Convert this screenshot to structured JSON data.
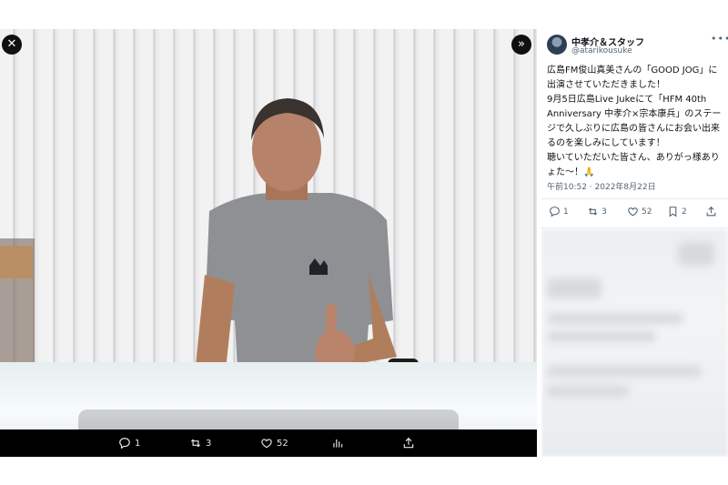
{
  "viewer": {
    "close_icon": "close-icon",
    "next_icon": "chevron-double-right-icon",
    "photo_description_icon": "photo",
    "bar": {
      "replies": "1",
      "retweets": "3",
      "likes": "52"
    }
  },
  "tweet": {
    "author_name": "中孝介＆スタッフ",
    "author_handle": "@atarikousuke",
    "lines": [
      "広島FM俊山真美さんの「GOOD JOG」に出演させていただきました！",
      "9月5日広島Live Jukeにて「HFM 40th Anniversary 中孝介×宗本康兵」のステージで久しぶりに広島の皆さんにお会い出来るのを楽しみにしています！",
      "聴いていただいた皆さん、ありがっ様ありょた〜！🙏"
    ],
    "timestamp": "午前10:52 · 2022年8月22日",
    "stats": {
      "replies": "1",
      "retweets": "3",
      "likes": "52",
      "bookmarks": "2"
    }
  },
  "colors": {
    "viewer_bg": "#000000",
    "text_primary": "#0f1419",
    "text_secondary": "#536471",
    "divider": "#e6ecf0"
  }
}
